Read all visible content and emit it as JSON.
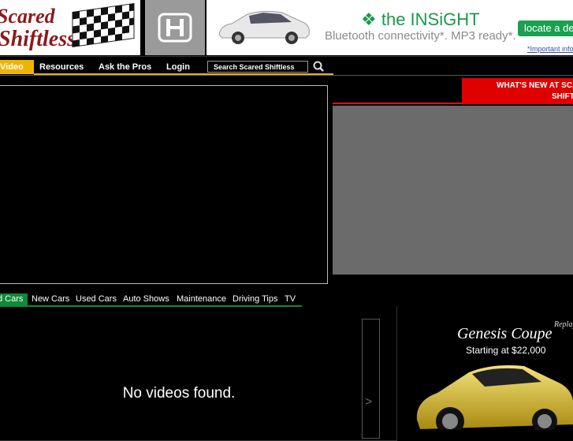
{
  "header": {
    "logo_line1": "Scared",
    "logo_line2": "Shiftless",
    "ad": {
      "brand": "the INSiGHT",
      "tagline": "Bluetooth connectivity*. MP3 ready*.",
      "button": "locate a de",
      "footnote": "*Important info"
    }
  },
  "nav": {
    "items": [
      "Video",
      "Resources",
      "Ask the Pros",
      "Login"
    ],
    "search_placeholder": "Search Scared Shiftless"
  },
  "whats_new": {
    "line1": "WHAT'S NEW AT SCA",
    "line2": "SHIFT"
  },
  "tabs": [
    "d Cars",
    "New Cars",
    "Used Cars",
    "Auto Shows",
    "Maintenance",
    "Driving Tips",
    "TV"
  ],
  "video_list": {
    "empty_message": "No videos found.",
    "next_arrow": ">"
  },
  "side_ad": {
    "replay": "Replay",
    "title": "Genesis Coupe",
    "price": "Starting at $22,000"
  },
  "colors": {
    "nav_accent": "#f0b400",
    "tab_accent": "#0f8a3a",
    "whats_new": "#e00000"
  }
}
